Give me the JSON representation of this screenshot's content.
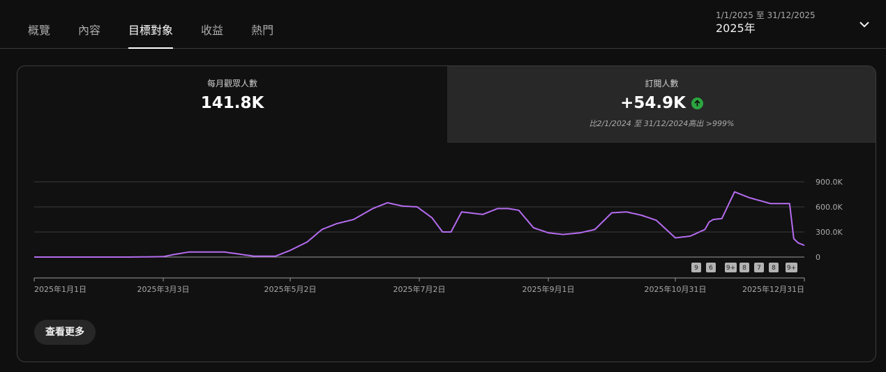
{
  "tabs": [
    {
      "label": "概覽"
    },
    {
      "label": "內容"
    },
    {
      "label": "目標對象"
    },
    {
      "label": "收益"
    },
    {
      "label": "熱門"
    }
  ],
  "active_tab": 2,
  "date_range": {
    "range": "1/1/2025 至 31/12/2025",
    "label": "2025年"
  },
  "metrics": {
    "viewers": {
      "title": "每月觀眾人數",
      "value": "141.8K"
    },
    "subscribers": {
      "title": "訂閱人數",
      "value": "+54.9K",
      "compare": "比2/1/2024 至 31/12/2024高出 >999%",
      "trend": "up",
      "trend_color": "#2ba640"
    }
  },
  "chart_data": {
    "type": "line",
    "series": [
      {
        "color": "#b56cf0",
        "x": [
          "2025-01-01",
          "2025-02-15",
          "2025-03-03",
          "2025-03-08",
          "2025-03-15",
          "2025-04-01",
          "2025-04-15",
          "2025-04-25",
          "2025-05-02",
          "2025-05-10",
          "2025-05-17",
          "2025-05-24",
          "2025-06-01",
          "2025-06-10",
          "2025-06-17",
          "2025-06-24",
          "2025-07-01",
          "2025-07-08",
          "2025-07-13",
          "2025-07-17",
          "2025-07-22",
          "2025-08-01",
          "2025-08-08",
          "2025-08-13",
          "2025-08-18",
          "2025-08-25",
          "2025-09-01",
          "2025-09-08",
          "2025-09-16",
          "2025-09-23",
          "2025-10-01",
          "2025-10-08",
          "2025-10-15",
          "2025-10-22",
          "2025-10-31",
          "2025-11-07",
          "2025-11-14",
          "2025-11-16",
          "2025-11-18",
          "2025-11-22",
          "2025-11-28",
          "2025-12-05",
          "2025-12-15",
          "2025-12-24",
          "2025-12-26",
          "2025-12-28",
          "2025-12-31"
        ],
        "values": [
          0,
          0,
          5000,
          30000,
          60000,
          60000,
          10000,
          10000,
          80000,
          180000,
          330000,
          400000,
          450000,
          580000,
          650000,
          610000,
          600000,
          470000,
          300000,
          300000,
          540000,
          510000,
          580000,
          580000,
          560000,
          350000,
          290000,
          270000,
          290000,
          330000,
          530000,
          540000,
          500000,
          440000,
          230000,
          250000,
          330000,
          420000,
          450000,
          460000,
          780000,
          710000,
          640000,
          640000,
          220000,
          170000,
          140000
        ]
      }
    ],
    "y_ticks": [
      "900.0K",
      "600.0K",
      "300.0K",
      "0"
    ],
    "ylim": [
      0,
      900000
    ],
    "x_ticks": [
      "2025年1月1日",
      "2025年3月3日",
      "2025年5月2日",
      "2025年7月2日",
      "2025年9月1日",
      "2025年10月31日",
      "2025年12月31日"
    ],
    "x_range": [
      "2025-01-01",
      "2025-12-31"
    ],
    "y_axis_position": "right",
    "grid": true,
    "event_badges": [
      "9",
      "6",
      "9+",
      "8",
      "7",
      "8",
      "9+"
    ]
  },
  "see_more_label": "查看更多",
  "icons": {
    "dropdown": "chevron-down-icon",
    "trend": "arrow-up-icon"
  }
}
